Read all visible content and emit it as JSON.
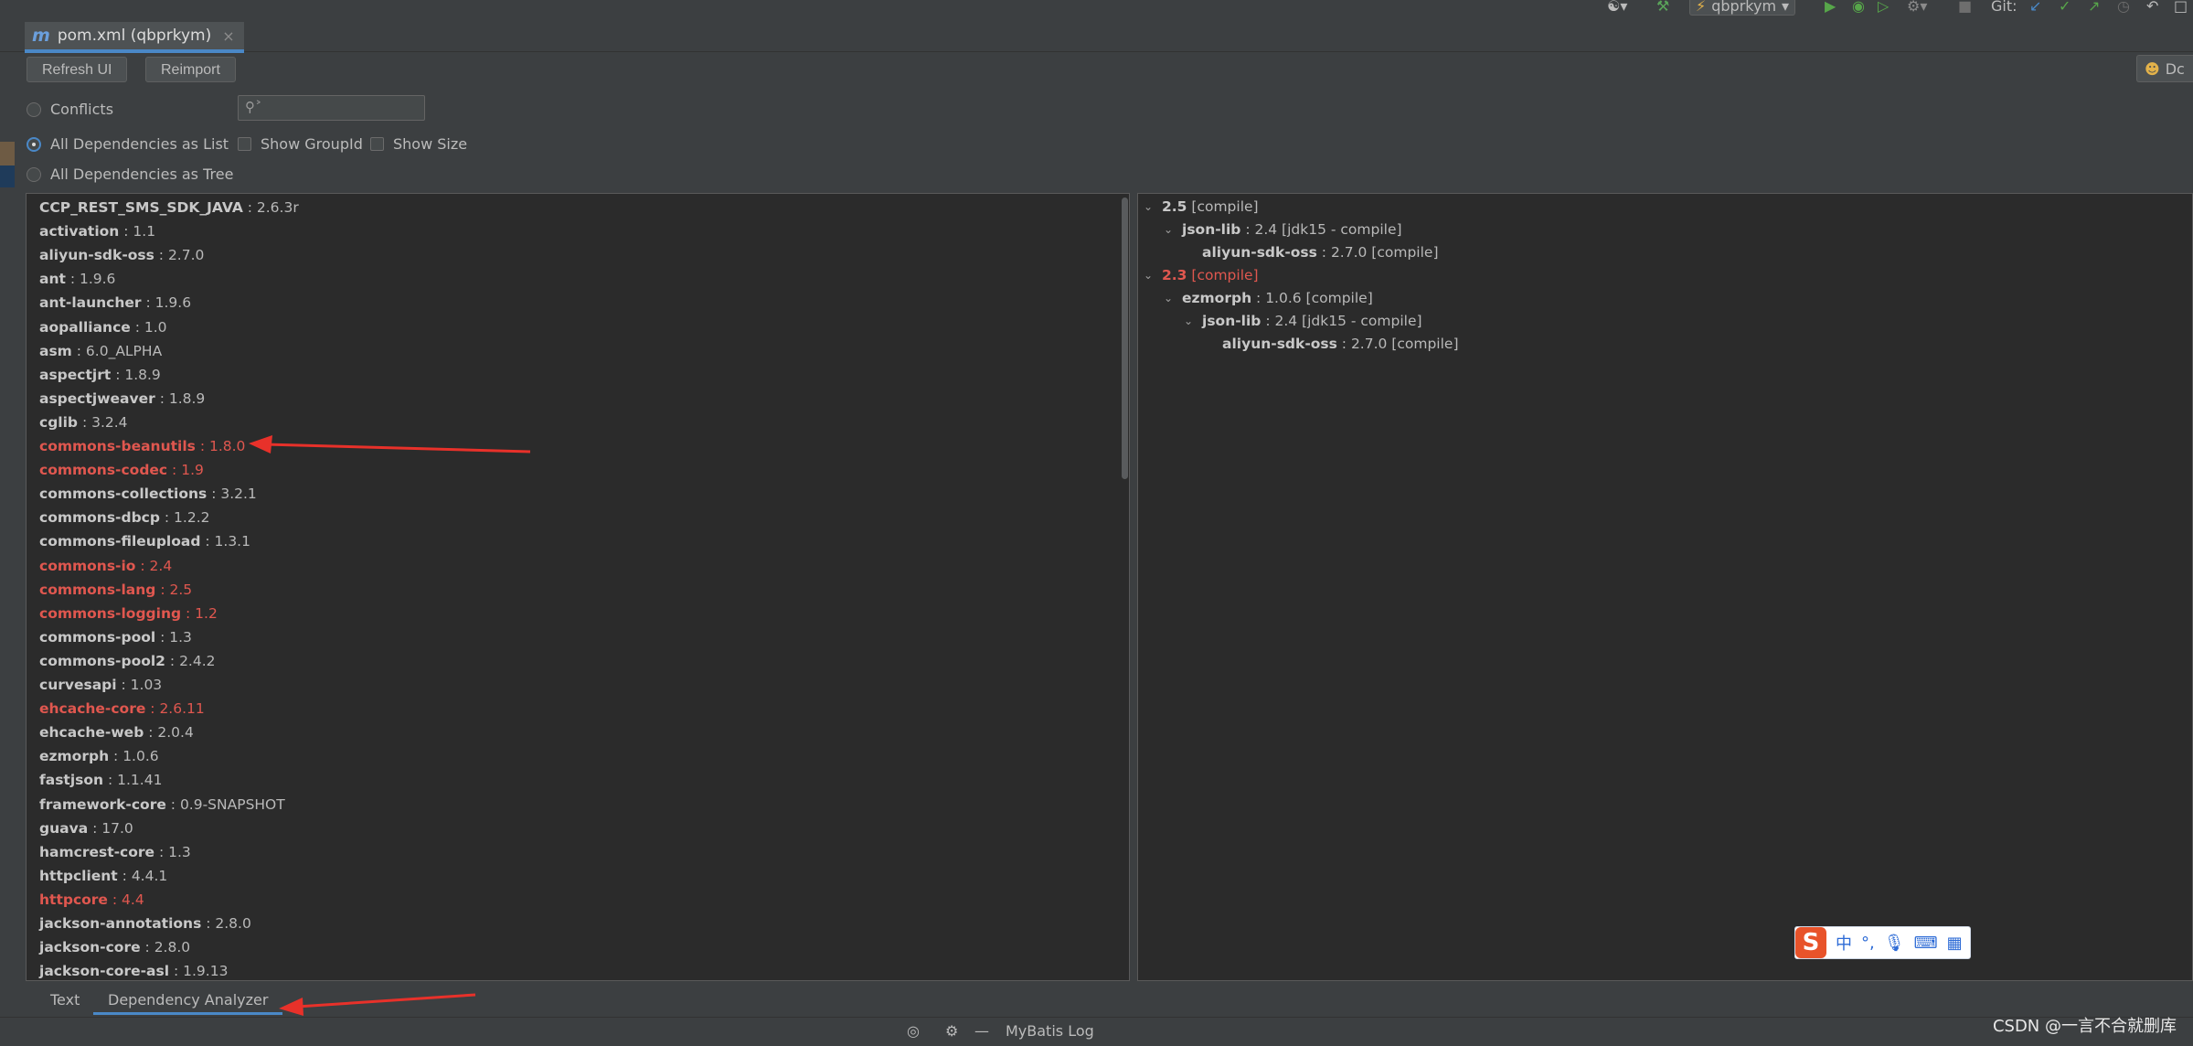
{
  "toolbar": {
    "run_config": "qbprkym",
    "git_label": "Git:"
  },
  "editor_tab": {
    "icon": "m",
    "title": "pom.xml (qbprkym)",
    "close": "×"
  },
  "actions": {
    "refresh": "Refresh UI",
    "reimport": "Reimport",
    "doc_button": "Dc"
  },
  "view_mode": {
    "conflicts": "Conflicts",
    "list": "All Dependencies as List",
    "tree": "All Dependencies as Tree",
    "selected": "list"
  },
  "search": {
    "placeholder": ""
  },
  "options": {
    "show_group_id": "Show GroupId",
    "show_size": "Show Size"
  },
  "dependencies": [
    {
      "name": "CCP_REST_SMS_SDK_JAVA",
      "version": "2.6.3r",
      "conflict": false
    },
    {
      "name": "activation",
      "version": "1.1",
      "conflict": false
    },
    {
      "name": "aliyun-sdk-oss",
      "version": "2.7.0",
      "conflict": false
    },
    {
      "name": "ant",
      "version": "1.9.6",
      "conflict": false
    },
    {
      "name": "ant-launcher",
      "version": "1.9.6",
      "conflict": false
    },
    {
      "name": "aopalliance",
      "version": "1.0",
      "conflict": false
    },
    {
      "name": "asm",
      "version": "6.0_ALPHA",
      "conflict": false
    },
    {
      "name": "aspectjrt",
      "version": "1.8.9",
      "conflict": false
    },
    {
      "name": "aspectjweaver",
      "version": "1.8.9",
      "conflict": false
    },
    {
      "name": "cglib",
      "version": "3.2.4",
      "conflict": false
    },
    {
      "name": "commons-beanutils",
      "version": "1.8.0",
      "conflict": true
    },
    {
      "name": "commons-codec",
      "version": "1.9",
      "conflict": true
    },
    {
      "name": "commons-collections",
      "version": "3.2.1",
      "conflict": false
    },
    {
      "name": "commons-dbcp",
      "version": "1.2.2",
      "conflict": false
    },
    {
      "name": "commons-fileupload",
      "version": "1.3.1",
      "conflict": false
    },
    {
      "name": "commons-io",
      "version": "2.4",
      "conflict": true
    },
    {
      "name": "commons-lang",
      "version": "2.5",
      "conflict": true
    },
    {
      "name": "commons-logging",
      "version": "1.2",
      "conflict": true
    },
    {
      "name": "commons-pool",
      "version": "1.3",
      "conflict": false
    },
    {
      "name": "commons-pool2",
      "version": "2.4.2",
      "conflict": false
    },
    {
      "name": "curvesapi",
      "version": "1.03",
      "conflict": false
    },
    {
      "name": "ehcache-core",
      "version": "2.6.11",
      "conflict": true
    },
    {
      "name": "ehcache-web",
      "version": "2.0.4",
      "conflict": false
    },
    {
      "name": "ezmorph",
      "version": "1.0.6",
      "conflict": false
    },
    {
      "name": "fastjson",
      "version": "1.1.41",
      "conflict": false
    },
    {
      "name": "framework-core",
      "version": "0.9-SNAPSHOT",
      "conflict": false
    },
    {
      "name": "guava",
      "version": "17.0",
      "conflict": false
    },
    {
      "name": "hamcrest-core",
      "version": "1.3",
      "conflict": false
    },
    {
      "name": "httpclient",
      "version": "4.4.1",
      "conflict": false
    },
    {
      "name": "httpcore",
      "version": "4.4",
      "conflict": true
    },
    {
      "name": "jackson-annotations",
      "version": "2.8.0",
      "conflict": false
    },
    {
      "name": "jackson-core",
      "version": "2.8.0",
      "conflict": false
    },
    {
      "name": "jackson-core-asl",
      "version": "1.9.13",
      "conflict": false
    }
  ],
  "usage_tree": [
    {
      "level": 0,
      "expanded": true,
      "name": "2.5",
      "detail": "[compile]",
      "conflict": false
    },
    {
      "level": 1,
      "expanded": true,
      "name": "json-lib",
      "detail": ": 2.4 [jdk15 - compile]",
      "conflict": false
    },
    {
      "level": 2,
      "expanded": false,
      "leaf": true,
      "name": "aliyun-sdk-oss",
      "detail": ": 2.7.0 [compile]",
      "conflict": false
    },
    {
      "level": 0,
      "expanded": true,
      "name": "2.3",
      "detail": "[compile]",
      "conflict": true
    },
    {
      "level": 1,
      "expanded": true,
      "name": "ezmorph",
      "detail": ": 1.0.6 [compile]",
      "conflict": false
    },
    {
      "level": 2,
      "expanded": true,
      "name": "json-lib",
      "detail": ": 2.4 [jdk15 - compile]",
      "conflict": false
    },
    {
      "level": 3,
      "expanded": false,
      "leaf": true,
      "name": "aliyun-sdk-oss",
      "detail": ": 2.7.0 [compile]",
      "conflict": false
    }
  ],
  "bottom_tabs": {
    "text": "Text",
    "analyzer": "Dependency Analyzer",
    "active": "analyzer"
  },
  "status_bar": {
    "mybatis_log": "MyBatis Log"
  },
  "ime": {
    "lang": "中",
    "punct": "°,"
  },
  "watermark": "CSDN @一言不合就删库",
  "colors": {
    "conflict": "#e0574f",
    "accent": "#4a88c7",
    "arrow": "#e8312a"
  }
}
